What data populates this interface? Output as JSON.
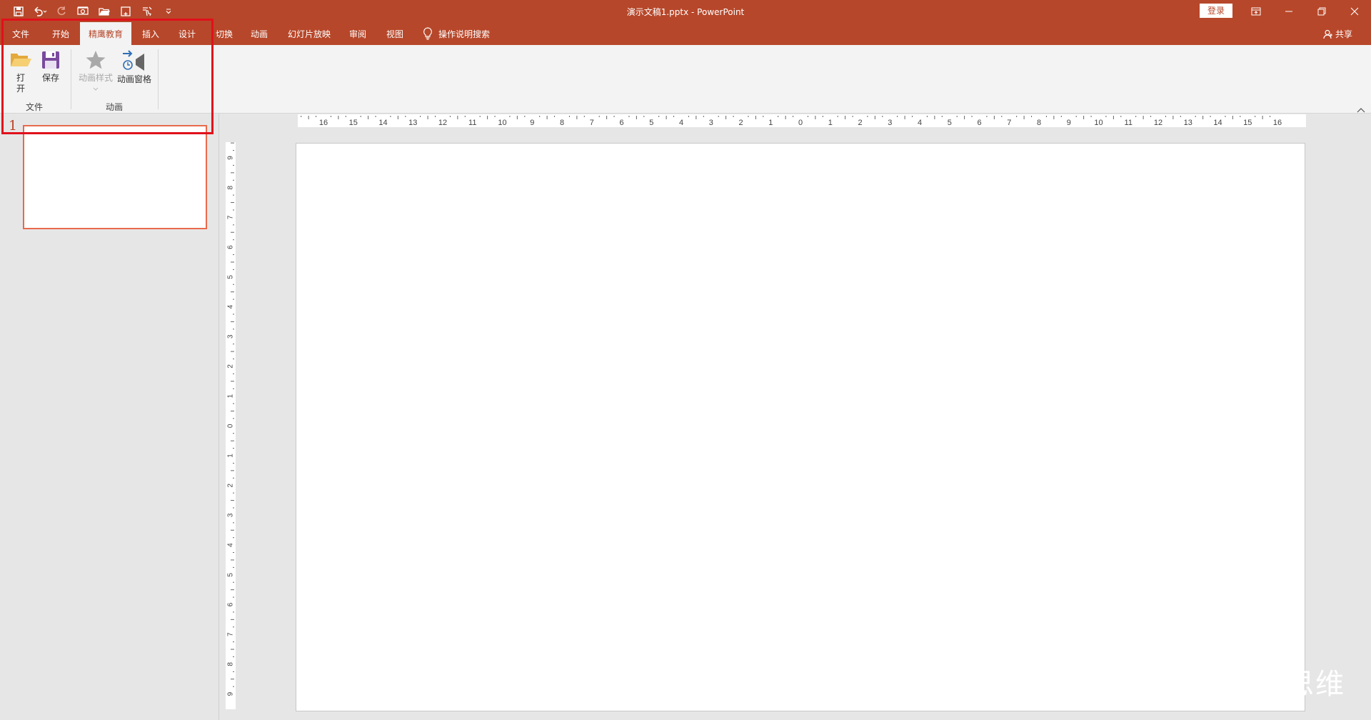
{
  "window": {
    "title": "演示文稿1.pptx  -  PowerPoint",
    "login_label": "登录",
    "share_label": "共享"
  },
  "colors": {
    "brand": "#b7472a",
    "highlight": "#e0111c",
    "thumb_border": "#e86a4c"
  },
  "quick_access": [
    {
      "name": "save-icon"
    },
    {
      "name": "undo-icon"
    },
    {
      "name": "redo-icon"
    },
    {
      "name": "present-icon"
    },
    {
      "name": "open-folder-icon"
    },
    {
      "name": "new-slide-icon"
    },
    {
      "name": "touch-mode-icon"
    },
    {
      "name": "customize-qat-icon"
    }
  ],
  "tabs": [
    {
      "label": "文件"
    },
    {
      "label": "开始"
    },
    {
      "label": "精鹰教育"
    },
    {
      "label": "插入"
    },
    {
      "label": "设计"
    },
    {
      "label": "切换"
    },
    {
      "label": "动画"
    },
    {
      "label": "幻灯片放映"
    },
    {
      "label": "审阅"
    },
    {
      "label": "视图"
    }
  ],
  "search": {
    "label": "操作说明搜索"
  },
  "ribbon": {
    "file_group": {
      "label": "文件",
      "open_label_1": "打",
      "open_label_2": "开",
      "save_label": "保存"
    },
    "animation_group": {
      "label": "动画",
      "styles_label": "动画样式",
      "pane_label": "动画窗格"
    }
  },
  "thumbnails": [
    {
      "number": "1"
    }
  ],
  "ruler": {
    "h_labels": [
      "16",
      "15",
      "14",
      "13",
      "12",
      "11",
      "10",
      "9",
      "8",
      "7",
      "6",
      "5",
      "4",
      "3",
      "2",
      "1",
      "0",
      "1",
      "2",
      "3",
      "4",
      "5",
      "6",
      "7",
      "8",
      "9",
      "10",
      "11",
      "12",
      "13",
      "14",
      "15",
      "16"
    ],
    "v_labels": [
      "9",
      "8",
      "7",
      "6",
      "5",
      "4",
      "3",
      "2",
      "1",
      "0",
      "1",
      "2",
      "3",
      "4",
      "5",
      "6",
      "7",
      "8",
      "9"
    ]
  },
  "watermark": "思维"
}
